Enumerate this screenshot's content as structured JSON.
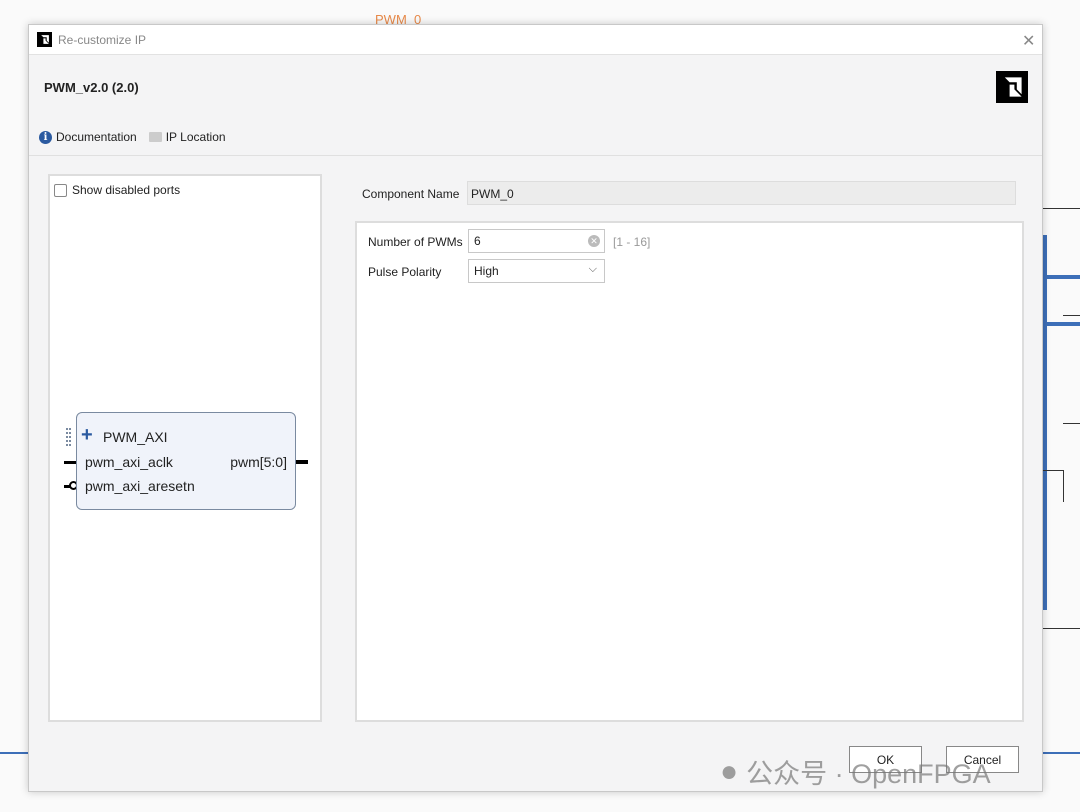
{
  "background": {
    "title": "PWM_0"
  },
  "dialog": {
    "title": "Re-customize IP",
    "ip_name": "PWM_v2.0 (2.0)",
    "links": [
      {
        "label": "Documentation",
        "icon": "info-icon"
      },
      {
        "label": "IP Location",
        "icon": "folder-icon"
      }
    ],
    "left": {
      "show_disabled_ports": {
        "label": "Show disabled ports",
        "checked": false
      },
      "block": {
        "interface": "PWM_AXI",
        "ports_in": [
          "pwm_axi_aclk",
          "pwm_axi_aresetn"
        ],
        "port_out": "pwm[5:0]"
      }
    },
    "component_name": {
      "label": "Component Name",
      "value": "PWM_0"
    },
    "params": {
      "num_pwms": {
        "label": "Number of PWMs",
        "value": "6",
        "range": "[1 - 16]"
      },
      "pulse_polarity": {
        "label": "Pulse Polarity",
        "value": "High"
      }
    },
    "buttons": {
      "ok": "OK",
      "cancel": "Cancel"
    }
  },
  "watermark": "公众号 · OpenFPGA",
  "colors": {
    "accent_blue": "#2b5aa0",
    "block_fill": "#f0f3fa"
  }
}
